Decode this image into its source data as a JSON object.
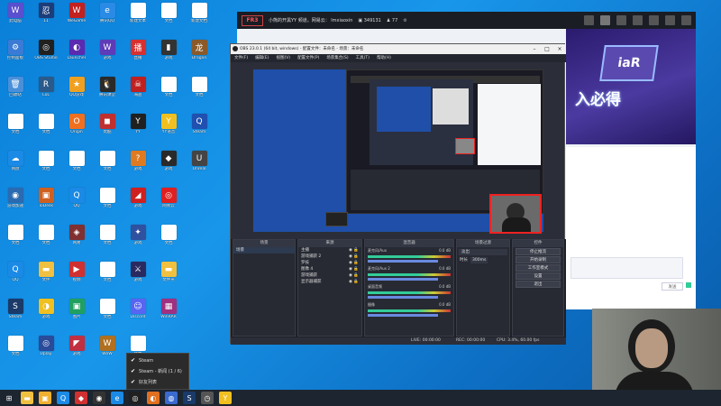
{
  "desktop": {
    "icons": [
      {
        "label": "此电脑",
        "glyph": "W",
        "color": "#5a4fcf",
        "col": 0,
        "row": 0
      },
      {
        "label": "11",
        "glyph": "忍",
        "color": "#1c3c7a",
        "col": 1,
        "row": 0
      },
      {
        "label": "WeGame",
        "glyph": "W",
        "color": "#c32020",
        "col": 2,
        "row": 0
      },
      {
        "label": "腾讯QQ",
        "glyph": "e",
        "color": "#2a8be6",
        "col": 3,
        "row": 0
      },
      {
        "label": "新建文本",
        "glyph": "",
        "color": "doc",
        "col": 4,
        "row": 0
      },
      {
        "label": "文档",
        "glyph": "",
        "color": "doc",
        "col": 5,
        "row": 0
      },
      {
        "label": "新建文档",
        "glyph": "",
        "color": "doc",
        "col": 6,
        "row": 0
      },
      {
        "label": "控制面板",
        "glyph": "⚙",
        "color": "#3a7bd5",
        "col": 0,
        "row": 1
      },
      {
        "label": "OBS Studio",
        "glyph": "◎",
        "color": "#202020",
        "col": 1,
        "row": 1
      },
      {
        "label": "Launcher",
        "glyph": "◐",
        "color": "#5a2ab0",
        "col": 2,
        "row": 1
      },
      {
        "label": "游戏",
        "glyph": "W",
        "color": "#5e3bb8",
        "col": 3,
        "row": 1
      },
      {
        "label": "直播",
        "glyph": "播",
        "color": "#d83030",
        "col": 4,
        "row": 1
      },
      {
        "label": "游戏",
        "glyph": "▮",
        "color": "#333",
        "col": 5,
        "row": 1
      },
      {
        "label": "Dragon",
        "glyph": "龙",
        "color": "#8a5a2a",
        "col": 6,
        "row": 1
      },
      {
        "label": "回收站",
        "glyph": "🗑",
        "color": "#4a90d9",
        "col": 0,
        "row": 2
      },
      {
        "label": "LoL",
        "glyph": "R",
        "color": "#2a5a8a",
        "col": 1,
        "row": 2
      },
      {
        "label": "QQ游戏",
        "glyph": "★",
        "color": "#f0a020",
        "col": 2,
        "row": 2
      },
      {
        "label": "腾讯课堂",
        "glyph": "🐧",
        "color": "#2a2a2a",
        "col": 3,
        "row": 2
      },
      {
        "label": "海盗",
        "glyph": "☠",
        "color": "#c02020",
        "col": 4,
        "row": 2
      },
      {
        "label": "文档",
        "glyph": "",
        "color": "doc",
        "col": 5,
        "row": 2
      },
      {
        "label": "文档",
        "glyph": "",
        "color": "doc",
        "col": 6,
        "row": 2
      },
      {
        "label": "文档",
        "glyph": "",
        "color": "doc",
        "col": 0,
        "row": 3
      },
      {
        "label": "文档",
        "glyph": "",
        "color": "doc",
        "col": 1,
        "row": 3
      },
      {
        "label": "Origin",
        "glyph": "O",
        "color": "#f07020",
        "col": 2,
        "row": 3
      },
      {
        "label": "优酷",
        "glyph": "◼",
        "color": "#c03030",
        "col": 3,
        "row": 3
      },
      {
        "label": "YY",
        "glyph": "Y",
        "color": "#202020",
        "col": 4,
        "row": 3
      },
      {
        "label": "YY语音",
        "glyph": "Y",
        "color": "#f0c020",
        "col": 5,
        "row": 3
      },
      {
        "label": "Steam",
        "glyph": "Q",
        "color": "#2050b0",
        "col": 6,
        "row": 3
      },
      {
        "label": "网盘",
        "glyph": "☁",
        "color": "#1a8ae6",
        "col": 0,
        "row": 4
      },
      {
        "label": "文档",
        "glyph": "",
        "color": "doc",
        "col": 1,
        "row": 4
      },
      {
        "label": "文档",
        "glyph": "",
        "color": "doc",
        "col": 2,
        "row": 4
      },
      {
        "label": "文档",
        "glyph": "",
        "color": "doc",
        "col": 3,
        "row": 4
      },
      {
        "label": "游戏",
        "glyph": "?",
        "color": "#e07a20",
        "col": 4,
        "row": 4
      },
      {
        "label": "游戏",
        "glyph": "◆",
        "color": "#2a2a2a",
        "col": 5,
        "row": 4
      },
      {
        "label": "Unreal",
        "glyph": "U",
        "color": "#444",
        "col": 6,
        "row": 4
      },
      {
        "label": "游戏加速",
        "glyph": "◉",
        "color": "#2a6ab0",
        "col": 0,
        "row": 5
      },
      {
        "label": "ToDesk",
        "glyph": "▣",
        "color": "#d06020",
        "col": 1,
        "row": 5
      },
      {
        "label": "QQ",
        "glyph": "Q",
        "color": "#1a8ae6",
        "col": 2,
        "row": 5
      },
      {
        "label": "文档",
        "glyph": "",
        "color": "doc",
        "col": 3,
        "row": 5
      },
      {
        "label": "游戏",
        "glyph": "◢",
        "color": "#d02020",
        "col": 4,
        "row": 5
      },
      {
        "label": "网易云",
        "glyph": "◎",
        "color": "#e02020",
        "col": 5,
        "row": 5
      },
      {
        "label": "文档",
        "glyph": "",
        "color": "doc",
        "col": 0,
        "row": 6
      },
      {
        "label": "文档",
        "glyph": "",
        "color": "doc",
        "col": 1,
        "row": 6
      },
      {
        "label": "网易",
        "glyph": "◈",
        "color": "#803030",
        "col": 2,
        "row": 6
      },
      {
        "label": "文档",
        "glyph": "",
        "color": "doc",
        "col": 3,
        "row": 6
      },
      {
        "label": "游戏",
        "glyph": "✦",
        "color": "#3050a0",
        "col": 4,
        "row": 6
      },
      {
        "label": "文档",
        "glyph": "",
        "color": "doc",
        "col": 5,
        "row": 6
      },
      {
        "label": "QQ",
        "glyph": "Q",
        "color": "#1a8ae6",
        "col": 0,
        "row": 7
      },
      {
        "label": "文件",
        "glyph": "▬",
        "color": "#f0c040",
        "col": 1,
        "row": 7
      },
      {
        "label": "视频",
        "glyph": "▶",
        "color": "#d03030",
        "col": 2,
        "row": 7
      },
      {
        "label": "文档",
        "glyph": "",
        "color": "doc",
        "col": 3,
        "row": 7
      },
      {
        "label": "游戏",
        "glyph": "⚔",
        "color": "#2a2a60",
        "col": 4,
        "row": 7
      },
      {
        "label": "文件夹",
        "glyph": "▬",
        "color": "#f0c040",
        "col": 5,
        "row": 7
      },
      {
        "label": "Steam",
        "glyph": "S",
        "color": "#1a3a6a",
        "col": 0,
        "row": 8
      },
      {
        "label": "游戏",
        "glyph": "◑",
        "color": "#f0c020",
        "col": 1,
        "row": 8
      },
      {
        "label": "图片",
        "glyph": "▣",
        "color": "#20a060",
        "col": 2,
        "row": 8
      },
      {
        "label": "文档",
        "glyph": "",
        "color": "doc",
        "col": 3,
        "row": 8
      },
      {
        "label": "Discord",
        "glyph": "☺",
        "color": "#5865f2",
        "col": 4,
        "row": 8
      },
      {
        "label": "WinRAR",
        "glyph": "▦",
        "color": "#a03080",
        "col": 5,
        "row": 8
      },
      {
        "label": "文档",
        "glyph": "",
        "color": "doc",
        "col": 0,
        "row": 9
      },
      {
        "label": "Uplay",
        "glyph": "◎",
        "color": "#2a4a9a",
        "col": 1,
        "row": 9
      },
      {
        "label": "游戏",
        "glyph": "◤",
        "color": "#c03040",
        "col": 2,
        "row": 9
      },
      {
        "label": "WoW",
        "glyph": "W",
        "color": "#b07020",
        "col": 3,
        "row": 9
      },
      {
        "label": "文档",
        "glyph": "",
        "color": "doc",
        "col": 4,
        "row": 9
      }
    ]
  },
  "taskbar": {
    "items": [
      {
        "name": "start-button",
        "glyph": "⊞",
        "color": "#1c2530"
      },
      {
        "name": "explorer-icon",
        "glyph": "▬",
        "color": "#f0c040"
      },
      {
        "name": "folder-icon",
        "glyph": "▣",
        "color": "#f0b030"
      },
      {
        "name": "qq-icon",
        "glyph": "Q",
        "color": "#1a8ae6"
      },
      {
        "name": "game-icon",
        "glyph": "◆",
        "color": "#d03030"
      },
      {
        "name": "app-icon",
        "glyph": "◉",
        "color": "#333"
      },
      {
        "name": "ie-icon",
        "glyph": "e",
        "color": "#1a8ae6"
      },
      {
        "name": "obs-icon",
        "glyph": "◎",
        "color": "#202020"
      },
      {
        "name": "browser-icon",
        "glyph": "◐",
        "color": "#e07020"
      },
      {
        "name": "app2-icon",
        "glyph": "◍",
        "color": "#3a6ad0"
      },
      {
        "name": "steam-icon",
        "glyph": "S",
        "color": "#1a3a6a"
      },
      {
        "name": "clock-icon",
        "glyph": "◷",
        "color": "#555"
      },
      {
        "name": "yy-icon",
        "glyph": "Y",
        "color": "#f0c020"
      }
    ]
  },
  "popup": {
    "items": [
      "Steam",
      "Steam - 新闻 (1 / 6)",
      "好友列表"
    ]
  },
  "stream": {
    "logo": "FR3",
    "title": "小熊的开黑YY 频道。网易云： lmxiaoxin",
    "id": "349131",
    "viewers": "77",
    "banner_text": "入必得",
    "banner_art": "iaR",
    "send_label": "发送",
    "nav_icons": [
      "video-icon",
      "home-icon",
      "clipboard-icon",
      "gamepad-icon",
      "menu-icon",
      "minimize-icon",
      "close-icon"
    ]
  },
  "obs": {
    "title": "OBS 23.0.1 (64 bit, windows) - 配置文件：未命名 - 场景：未命名",
    "menu": [
      "文件(F)",
      "编辑(E)",
      "视图(V)",
      "配置文件(P)",
      "场景集合(S)",
      "工具(T)",
      "帮助(H)"
    ],
    "docks": {
      "scenes": {
        "title": "场景",
        "items": [
          "场景"
        ]
      },
      "sources": {
        "title": "来源",
        "items": [
          "主播",
          "游戏捕获 2",
          "罗技",
          "图像 4",
          "游戏捕获",
          "显示器捕获"
        ]
      },
      "mixer": {
        "title": "混音器",
        "rows": [
          {
            "name": "麦克风/Aux",
            "db": "0.0 dB"
          },
          {
            "name": "麦克风/Aux 2",
            "db": "0.0 dB"
          },
          {
            "name": "桌面音频",
            "db": "0.0 dB"
          },
          {
            "name": "摄像",
            "db": "0.0 dB"
          }
        ]
      },
      "transitions": {
        "title": "场景过渡",
        "type": "淡出",
        "duration_label": "时长",
        "duration": "300ms"
      },
      "controls": {
        "title": "控件",
        "buttons": [
          "停止推流",
          "开始录制",
          "工作室模式",
          "设置",
          "退出"
        ]
      }
    },
    "status": {
      "live": "LIVE: 00:00:00",
      "rec": "REC: 00:00:00",
      "cpu": "CPU: 3.4%, 60.00 fps"
    }
  }
}
